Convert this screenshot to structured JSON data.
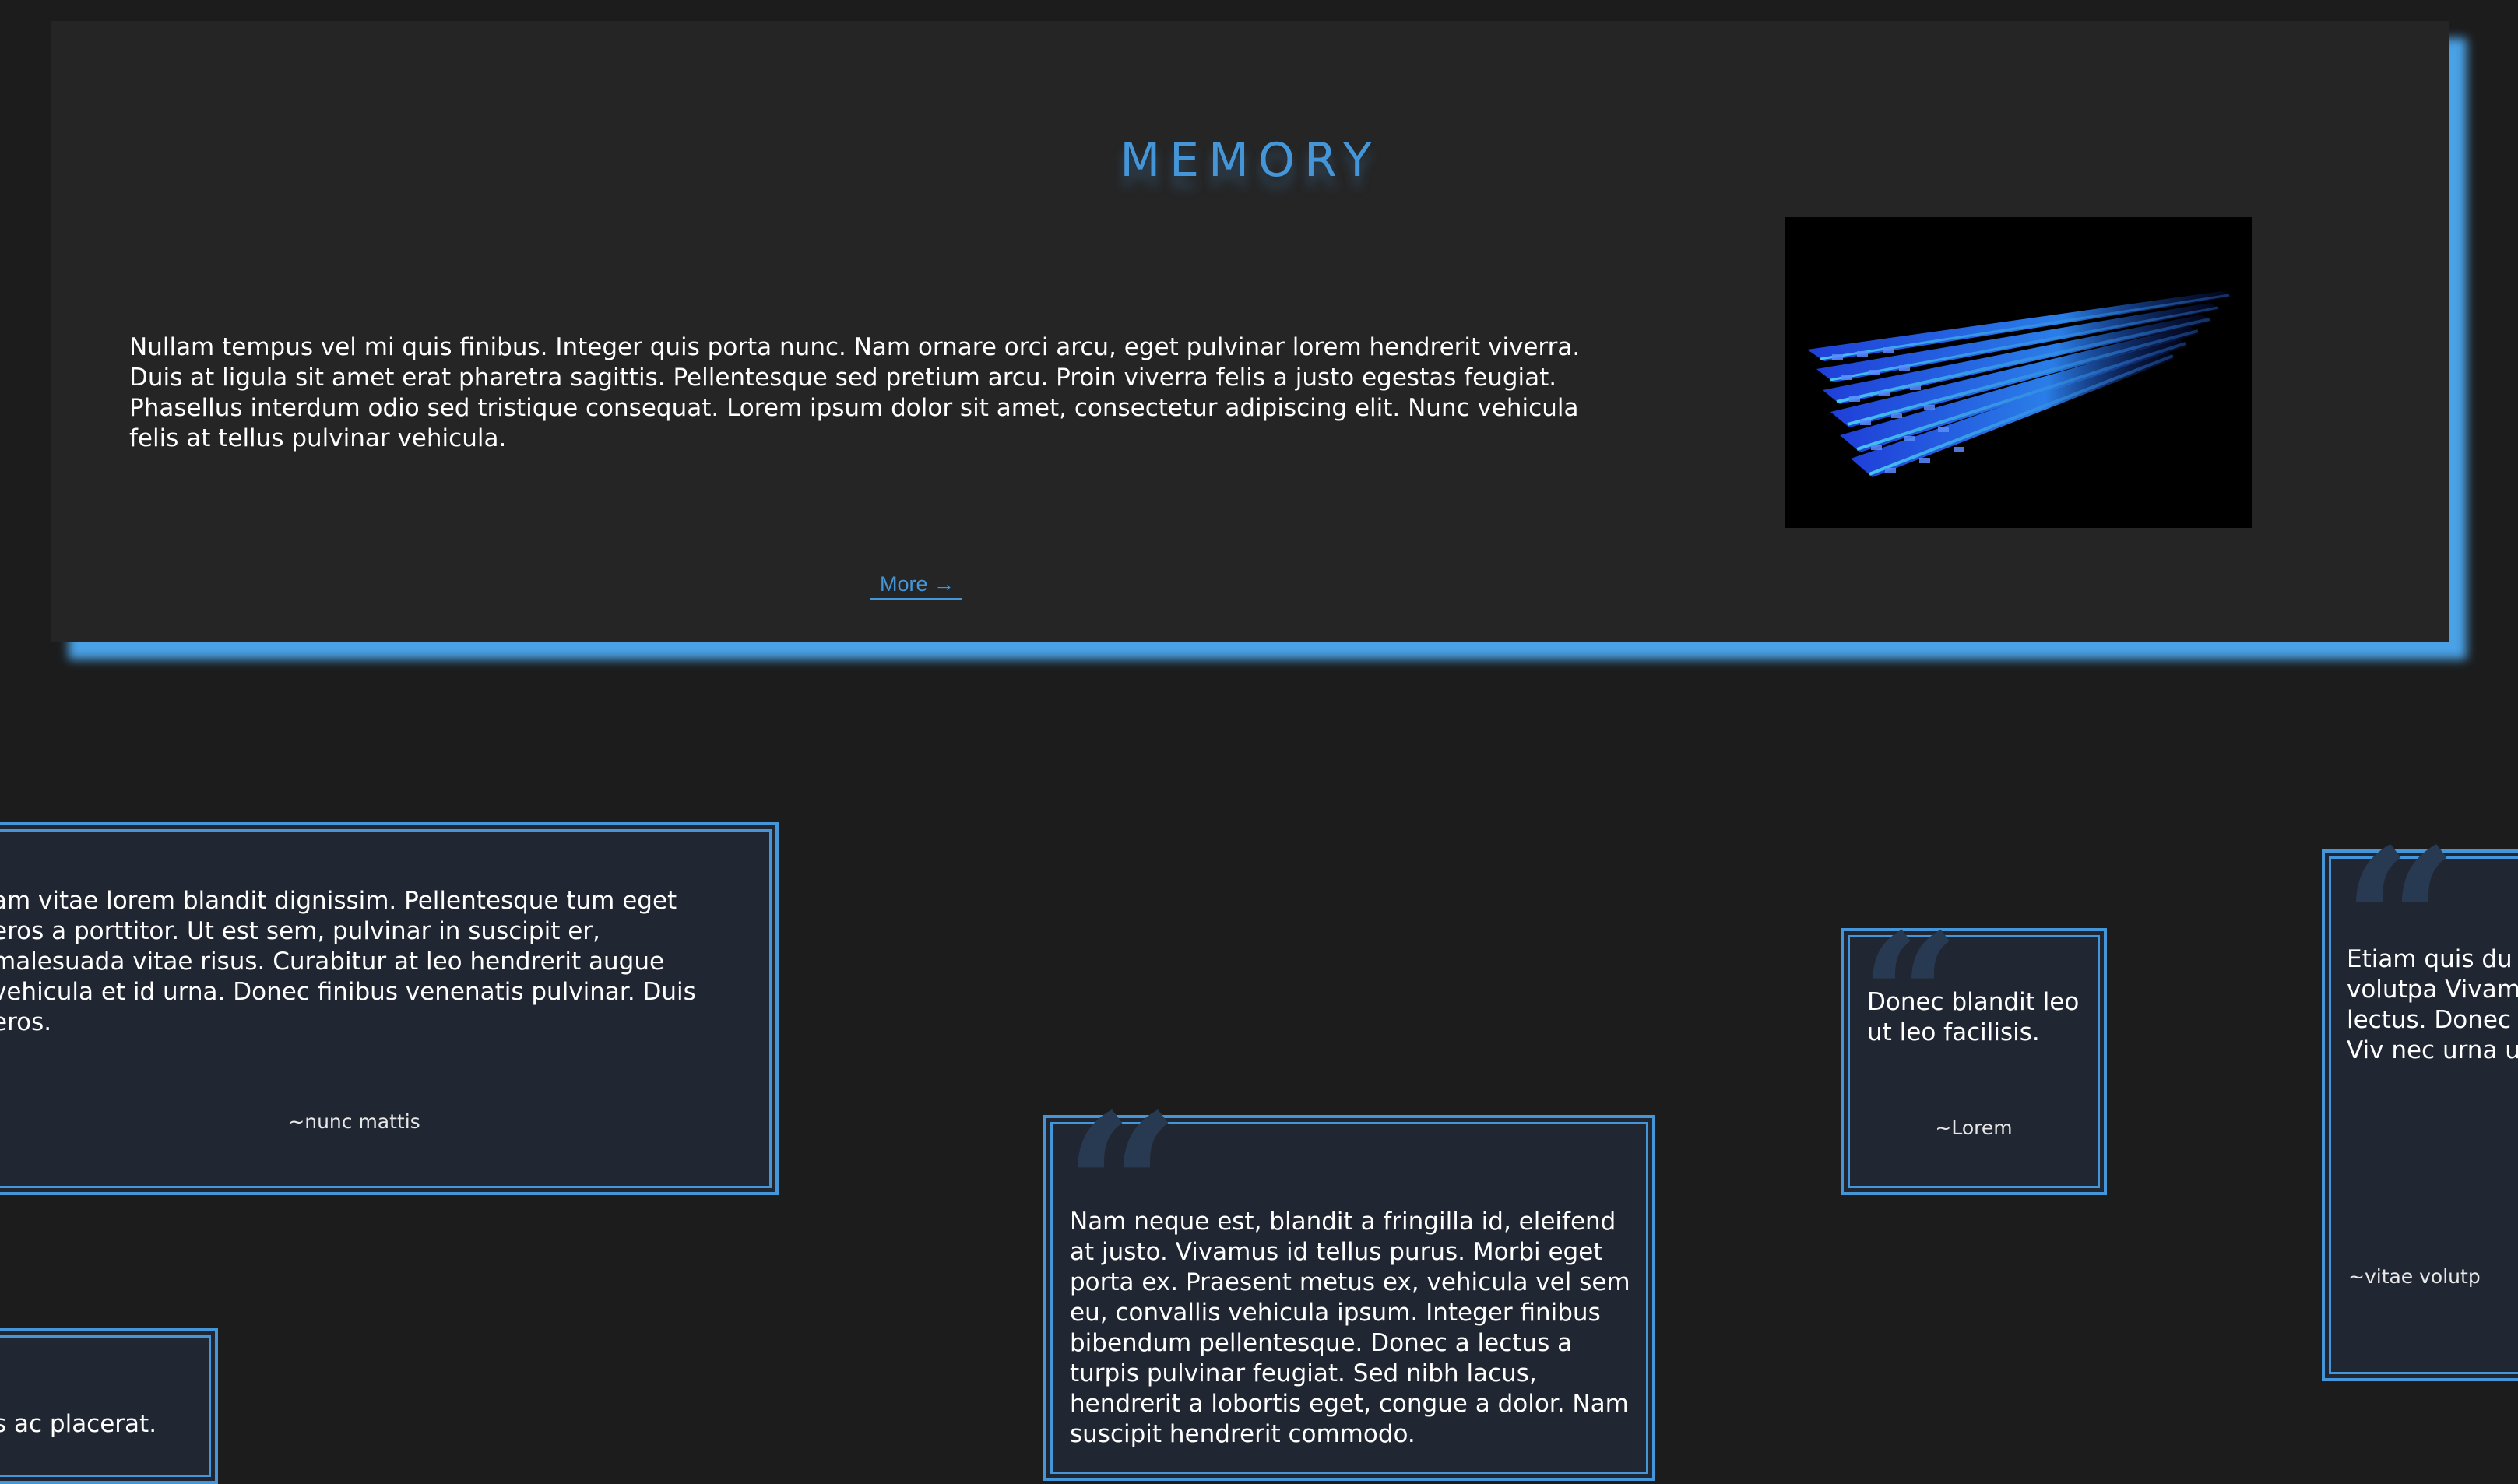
{
  "hero": {
    "title": "MEMORY",
    "body": "Nullam tempus vel mi quis finibus. Integer quis porta nunc. Nam ornare orci arcu, eget pulvinar lorem hendrerit viverra. Duis at ligula sit amet erat pharetra sagittis. Pellentesque sed pretium arcu. Proin viverra felis a justo egestas feugiat. Phasellus interdum odio sed tristique consequat. Lorem ipsum dolor sit amet, consectetur adipiscing elit. Nunc vehicula felis at tellus pulvinar vehicula.",
    "link_label": "More →"
  },
  "quotes": [
    {
      "text": "am vitae lorem blandit dignissim. Pellentesque tum eget eros a porttitor. Ut est sem, pulvinar in suscipit er, malesuada vitae risus. Curabitur at leo hendrerit augue vehicula et id urna. Donec finibus venenatis pulvinar. Duis eros.",
      "author": "~nunc mattis"
    },
    {
      "text": "Nam neque est, blandit a fringilla id, eleifend at justo. Vivamus id tellus purus. Morbi eget porta ex. Praesent metus ex, vehicula vel sem eu, convallis vehicula ipsum. Integer finibus bibendum pellentesque. Donec a lectus a turpis pulvinar feugiat. Sed nibh lacus, hendrerit a lobortis eget, congue a dolor. Nam suscipit hendrerit commodo.",
      "author": ""
    },
    {
      "text": "Donec blandit leo ut leo facilisis.",
      "author": "~Lorem"
    },
    {
      "text": "Etiam quis du iaculis volutpa Vivamus vulpu lectus. Donec vulputate. Viv nec urna ut al",
      "author": "~vitae volutp"
    },
    {
      "text": "s ac placerat.",
      "author": ""
    }
  ],
  "quote_mark": "“",
  "colors": {
    "background": "#1c1c1c",
    "card": "#252525",
    "accent": "#4596d8",
    "quote_card": "#202632"
  }
}
